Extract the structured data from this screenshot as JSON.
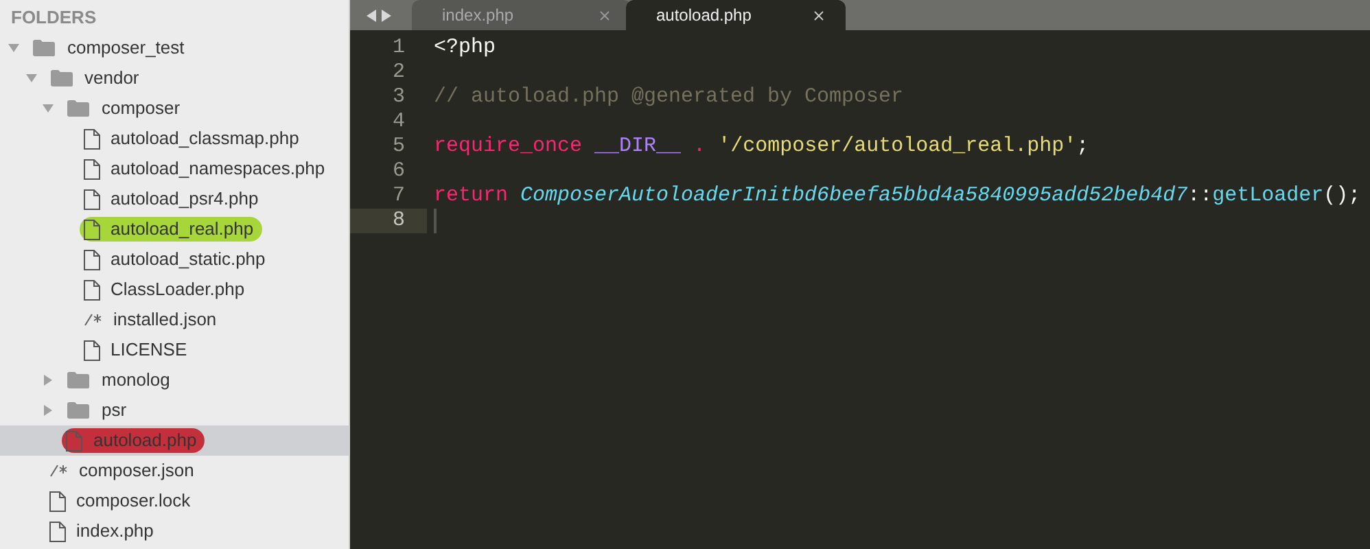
{
  "sidebar": {
    "title": "FOLDERS",
    "tree": [
      {
        "name": "composer_test",
        "kind": "folder",
        "expanded": true,
        "selected": false,
        "children": [
          {
            "name": "vendor",
            "kind": "folder",
            "expanded": true,
            "selected": false,
            "children": [
              {
                "name": "composer",
                "kind": "folder",
                "expanded": true,
                "selected": false,
                "children": [
                  {
                    "name": "autoload_classmap.php",
                    "kind": "file",
                    "selected": false
                  },
                  {
                    "name": "autoload_namespaces.php",
                    "kind": "file",
                    "selected": false
                  },
                  {
                    "name": "autoload_psr4.php",
                    "kind": "file",
                    "selected": false
                  },
                  {
                    "name": "autoload_real.php",
                    "kind": "file",
                    "selected": false,
                    "color": "#a6d63a"
                  },
                  {
                    "name": "autoload_static.php",
                    "kind": "file",
                    "selected": false
                  },
                  {
                    "name": "ClassLoader.php",
                    "kind": "file",
                    "selected": false
                  },
                  {
                    "name": "installed.json",
                    "kind": "json",
                    "selected": false
                  },
                  {
                    "name": "LICENSE",
                    "kind": "file",
                    "selected": false
                  }
                ]
              },
              {
                "name": "monolog",
                "kind": "folder",
                "expanded": false,
                "selected": false
              },
              {
                "name": "psr",
                "kind": "folder",
                "expanded": false,
                "selected": false
              },
              {
                "name": "autoload.php",
                "kind": "file",
                "selected": true,
                "color": "#c3303b"
              }
            ]
          },
          {
            "name": "composer.json",
            "kind": "json",
            "selected": false
          },
          {
            "name": "composer.lock",
            "kind": "file",
            "selected": false
          },
          {
            "name": "index.php",
            "kind": "file",
            "selected": false
          }
        ]
      }
    ]
  },
  "tabs": [
    {
      "label": "index.php",
      "selected": false
    },
    {
      "label": "autoload.php",
      "selected": true
    }
  ],
  "editor": {
    "lines": [
      {
        "number": "1",
        "current": false,
        "tokens": [
          {
            "text": "<?php",
            "kind": "plain"
          }
        ]
      },
      {
        "number": "2",
        "current": false
      },
      {
        "number": "3",
        "current": false,
        "tokens": [
          {
            "text": "// autoload.php @generated by Composer",
            "kind": "comment"
          }
        ]
      },
      {
        "number": "4",
        "current": false
      },
      {
        "number": "5",
        "current": false,
        "tokens": [
          {
            "text": "require_once ",
            "kind": "keyword"
          },
          {
            "text": "__DIR__",
            "kind": "constant"
          },
          {
            "text": " . ",
            "kind": "keyword"
          },
          {
            "text": "'/composer/autoload_real.php'",
            "kind": "string"
          },
          {
            "text": ";",
            "kind": "plain"
          }
        ]
      },
      {
        "number": "6",
        "current": false
      },
      {
        "number": "7",
        "current": false,
        "tokens": [
          {
            "text": "return ",
            "kind": "keyword"
          },
          {
            "text": "ComposerAutoloaderInitbd6beefa5bbd4a5840995add52beb4d7",
            "kind": "class"
          },
          {
            "text": "::",
            "kind": "plain"
          },
          {
            "text": "getLoader",
            "kind": "function"
          },
          {
            "text": "();",
            "kind": "plain"
          }
        ]
      },
      {
        "number": "8",
        "current": true
      }
    ]
  }
}
